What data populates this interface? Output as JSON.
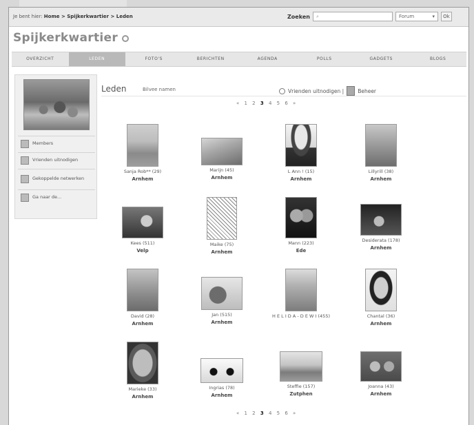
{
  "breadcrumb": {
    "prefix": "Je bent hier:",
    "path": "Home > Spijkerkwartier > Leden"
  },
  "search": {
    "label": "Zoeken",
    "placeholder": "",
    "scope": "Forum",
    "button": "Ok"
  },
  "group": {
    "title": "Spijkerkwartier"
  },
  "nav": [
    "OVERZICHT",
    "LEDEN",
    "FOTO'S",
    "BERICHTEN",
    "AGENDA",
    "POLLS",
    "GADGETS",
    "BLOGS"
  ],
  "sidebar": {
    "items": [
      {
        "label": "Members",
        "icon": "members-icon"
      },
      {
        "label": "Vrienden uitnodigen",
        "icon": "invite-icon"
      },
      {
        "label": "Gekoppelde netwerken",
        "icon": "network-icon"
      },
      {
        "label": "Ga naar de...",
        "icon": "group-icon"
      }
    ]
  },
  "content": {
    "title": "Leden",
    "subtitle": "Bilvee namen",
    "invite": "Vrienden uitnodigen |",
    "admin": "Beheer"
  },
  "pager": {
    "prefix": "«  1  2",
    "current": "3",
    "suffix": "4  5  6  »"
  },
  "members": [
    {
      "name": "Sanja Rob** (29)",
      "city": "Arnhem"
    },
    {
      "name": "Marijn (45)",
      "city": "Arnhem"
    },
    {
      "name": "L Ann ! (15)",
      "city": "Arnhem"
    },
    {
      "name": "Lillyrill (38)",
      "city": "Arnhem"
    },
    {
      "name": "Kees (511)",
      "city": "Velp"
    },
    {
      "name": "Maike (75)",
      "city": "Arnhem"
    },
    {
      "name": "Mann (223)",
      "city": "Ede"
    },
    {
      "name": "Desiderata (178)",
      "city": "Arnhem"
    },
    {
      "name": "David (28)",
      "city": "Arnhem"
    },
    {
      "name": "Jan (515)",
      "city": "Arnhem"
    },
    {
      "name": "H E L I D A - D E W I (455)",
      "city": ""
    },
    {
      "name": "Chantal (36)",
      "city": "Arnhem"
    },
    {
      "name": "Marieke (33)",
      "city": "Arnhem"
    },
    {
      "name": "Ingrias (78)",
      "city": "Arnhem"
    },
    {
      "name": "Steffie (157)",
      "city": "Zutphen"
    },
    {
      "name": "Joanna (43)",
      "city": "Arnhem"
    }
  ],
  "colors": {
    "accent": "#b9b9b9",
    "nav_bg": "#e6e6e6",
    "sidebar_bg": "#f0f0f0"
  }
}
